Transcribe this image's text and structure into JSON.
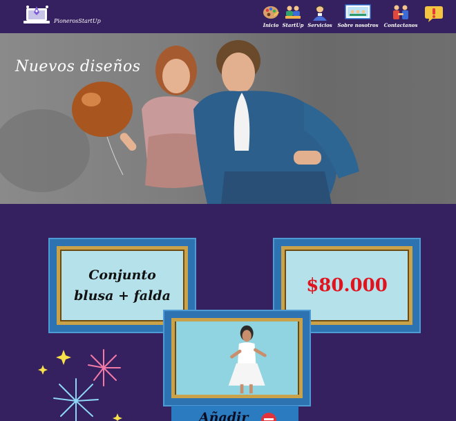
{
  "brand": {
    "name": "PionerosStartUp"
  },
  "nav": [
    {
      "label": "Inicio",
      "icon": "palette-icon"
    },
    {
      "label": "StartUp",
      "icon": "team-icon"
    },
    {
      "label": "Servicios",
      "icon": "support-person-icon"
    },
    {
      "label": "Sobre nosotros",
      "icon": "meeting-icon"
    },
    {
      "label": "Contactanos",
      "icon": "handshake-icon"
    }
  ],
  "alert_icon": "alert-bubble-icon",
  "hero": {
    "title": "Nuevos diseños"
  },
  "product": {
    "name_line1": "Conjunto",
    "name_line2": "blusa + falda",
    "price": "$80.000",
    "add_label": "Añadir"
  },
  "colors": {
    "background": "#35215f",
    "frame": "#2e73b1",
    "price": "#e0141e",
    "panel": "#b4e1ea"
  }
}
